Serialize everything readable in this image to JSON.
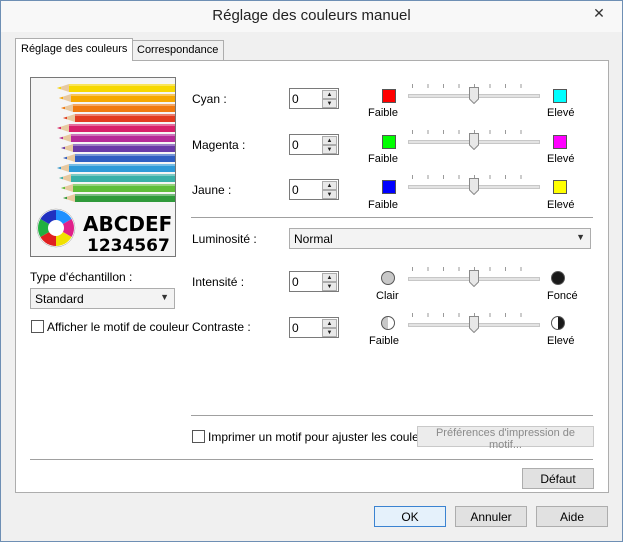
{
  "window": {
    "title": "Réglage des couleurs manuel"
  },
  "tabs": [
    {
      "label": "Réglage des couleurs"
    },
    {
      "label": "Correspondance"
    }
  ],
  "preview": {
    "sample_letters": "ABCDEF",
    "sample_digits": "1234567"
  },
  "sample_type": {
    "label": "Type d'échantillon :",
    "value": "Standard"
  },
  "show_pattern": {
    "label": "Afficher le motif de couleur",
    "checked": false
  },
  "color_rows": [
    {
      "label": "Cyan :",
      "value": "0",
      "low_label": "Faible",
      "high_label": "Elevé",
      "low_color": "#ff0000",
      "high_color": "#00ffff",
      "level": 0.5
    },
    {
      "label": "Magenta :",
      "value": "0",
      "low_label": "Faible",
      "high_label": "Elevé",
      "low_color": "#00ff00",
      "high_color": "#ff00ff",
      "level": 0.5
    },
    {
      "label": "Jaune :",
      "value": "0",
      "low_label": "Faible",
      "high_label": "Elevé",
      "low_color": "#0000ff",
      "high_color": "#ffff00",
      "level": 0.5
    }
  ],
  "brightness": {
    "label": "Luminosité :",
    "value": "Normal"
  },
  "intensity": {
    "label": "Intensité :",
    "value": "0",
    "low_label": "Clair",
    "high_label": "Foncé",
    "level": 0.5
  },
  "contrast": {
    "label": "Contraste :",
    "value": "0",
    "low_label": "Faible",
    "high_label": "Elevé",
    "level": 0.5
  },
  "print_pattern": {
    "label": "Imprimer un motif pour ajuster les couleurs",
    "checked": false
  },
  "print_prefs_button": "Préférences d'impression de motif...",
  "default_button": "Défaut",
  "footer": {
    "ok": "OK",
    "cancel": "Annuler",
    "help": "Aide"
  },
  "colors": {
    "accent": "#3b83d1",
    "panel_bg": "#ffffff",
    "window_bg": "#f0f0f0"
  }
}
